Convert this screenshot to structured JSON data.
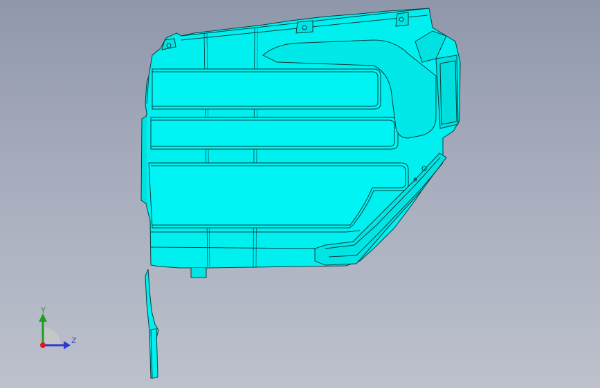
{
  "viewport": {
    "background_top": "#8f97ab",
    "background_bottom": "#bcc1cc"
  },
  "model": {
    "fill_color": "#00ffff",
    "edge_color": "#0a3d3d"
  },
  "triad": {
    "y_label": "Y",
    "z_label": "Z",
    "y_color": "#1f9e22",
    "z_color": "#2b3dcc",
    "x_color": "#e01a1a"
  }
}
